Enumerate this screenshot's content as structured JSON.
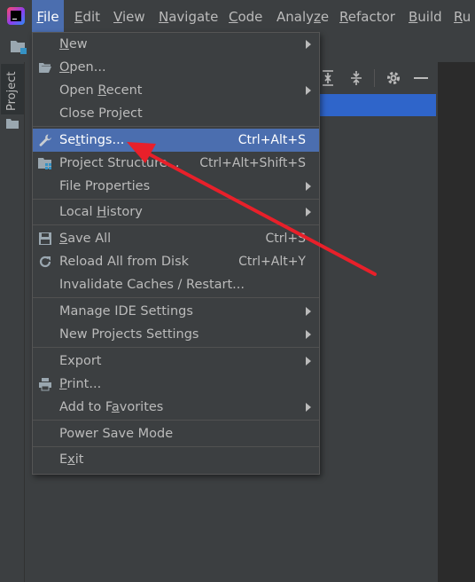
{
  "menubar": {
    "items": [
      {
        "label": "File",
        "mnemonic": "F",
        "rest": "ile"
      },
      {
        "label": "Edit",
        "mnemonic": "E",
        "rest": "dit"
      },
      {
        "label": "View",
        "mnemonic": "V",
        "rest": "iew"
      },
      {
        "label": "Navigate",
        "mnemonic": "N",
        "rest": "avigate"
      },
      {
        "label": "Code",
        "mnemonic": "C",
        "rest": "ode"
      },
      {
        "label": "Analyze",
        "pre": "Analy",
        "mnemonic": "z",
        "rest": "e"
      },
      {
        "label": "Refactor",
        "mnemonic": "R",
        "rest": "efactor"
      },
      {
        "label": "Build",
        "mnemonic": "B",
        "rest": "uild"
      },
      {
        "label": "Run",
        "mnemonic": "R",
        "rest": "u"
      }
    ]
  },
  "side_panel": {
    "project_tab_label": "Project"
  },
  "file_menu": {
    "items": [
      {
        "label": "New",
        "mnemonic": "N",
        "rest": "ew",
        "submenu": true
      },
      {
        "label": "Open...",
        "mnemonic": "O",
        "rest": "pen...",
        "icon": "folder-open-icon"
      },
      {
        "label": "Open Recent",
        "pre": "Open ",
        "mnemonic": "R",
        "rest": "ecent",
        "submenu": true
      },
      {
        "label": "Close Project"
      },
      {
        "label": "Settings...",
        "mnemonic": "t",
        "pre": "Se",
        "rest": "tings...",
        "shortcut": "Ctrl+Alt+S",
        "icon": "wrench-icon",
        "selected": true
      },
      {
        "label": "Project Structure...",
        "shortcut": "Ctrl+Alt+Shift+S",
        "icon": "project-structure-icon"
      },
      {
        "label": "File Properties",
        "submenu": true
      },
      {
        "label": "Local History",
        "pre": "Local ",
        "mnemonic": "H",
        "rest": "istory",
        "submenu": true
      },
      {
        "label": "Save All",
        "mnemonic": "S",
        "rest": "ave All",
        "shortcut": "Ctrl+S",
        "icon": "save-icon"
      },
      {
        "label": "Reload All from Disk",
        "shortcut": "Ctrl+Alt+Y",
        "icon": "reload-icon"
      },
      {
        "label": "Invalidate Caches / Restart..."
      },
      {
        "label": "Manage IDE Settings",
        "submenu": true
      },
      {
        "label": "New Projects Settings",
        "submenu": true
      },
      {
        "label": "Export",
        "submenu": true
      },
      {
        "label": "Print...",
        "mnemonic": "P",
        "rest": "rint...",
        "icon": "print-icon"
      },
      {
        "label": "Add to Favorites",
        "pre": "Add to F",
        "mnemonic": "a",
        "rest": "vorites",
        "submenu": true
      },
      {
        "label": "Power Save Mode"
      },
      {
        "label": "Exit",
        "mnemonic": "x",
        "pre": "E",
        "rest": "it"
      }
    ]
  },
  "colors": {
    "background": "#3c3f41",
    "selection": "#4b6eaf",
    "annotation_arrow": "#e8202a",
    "text": "#bbbbbb"
  }
}
